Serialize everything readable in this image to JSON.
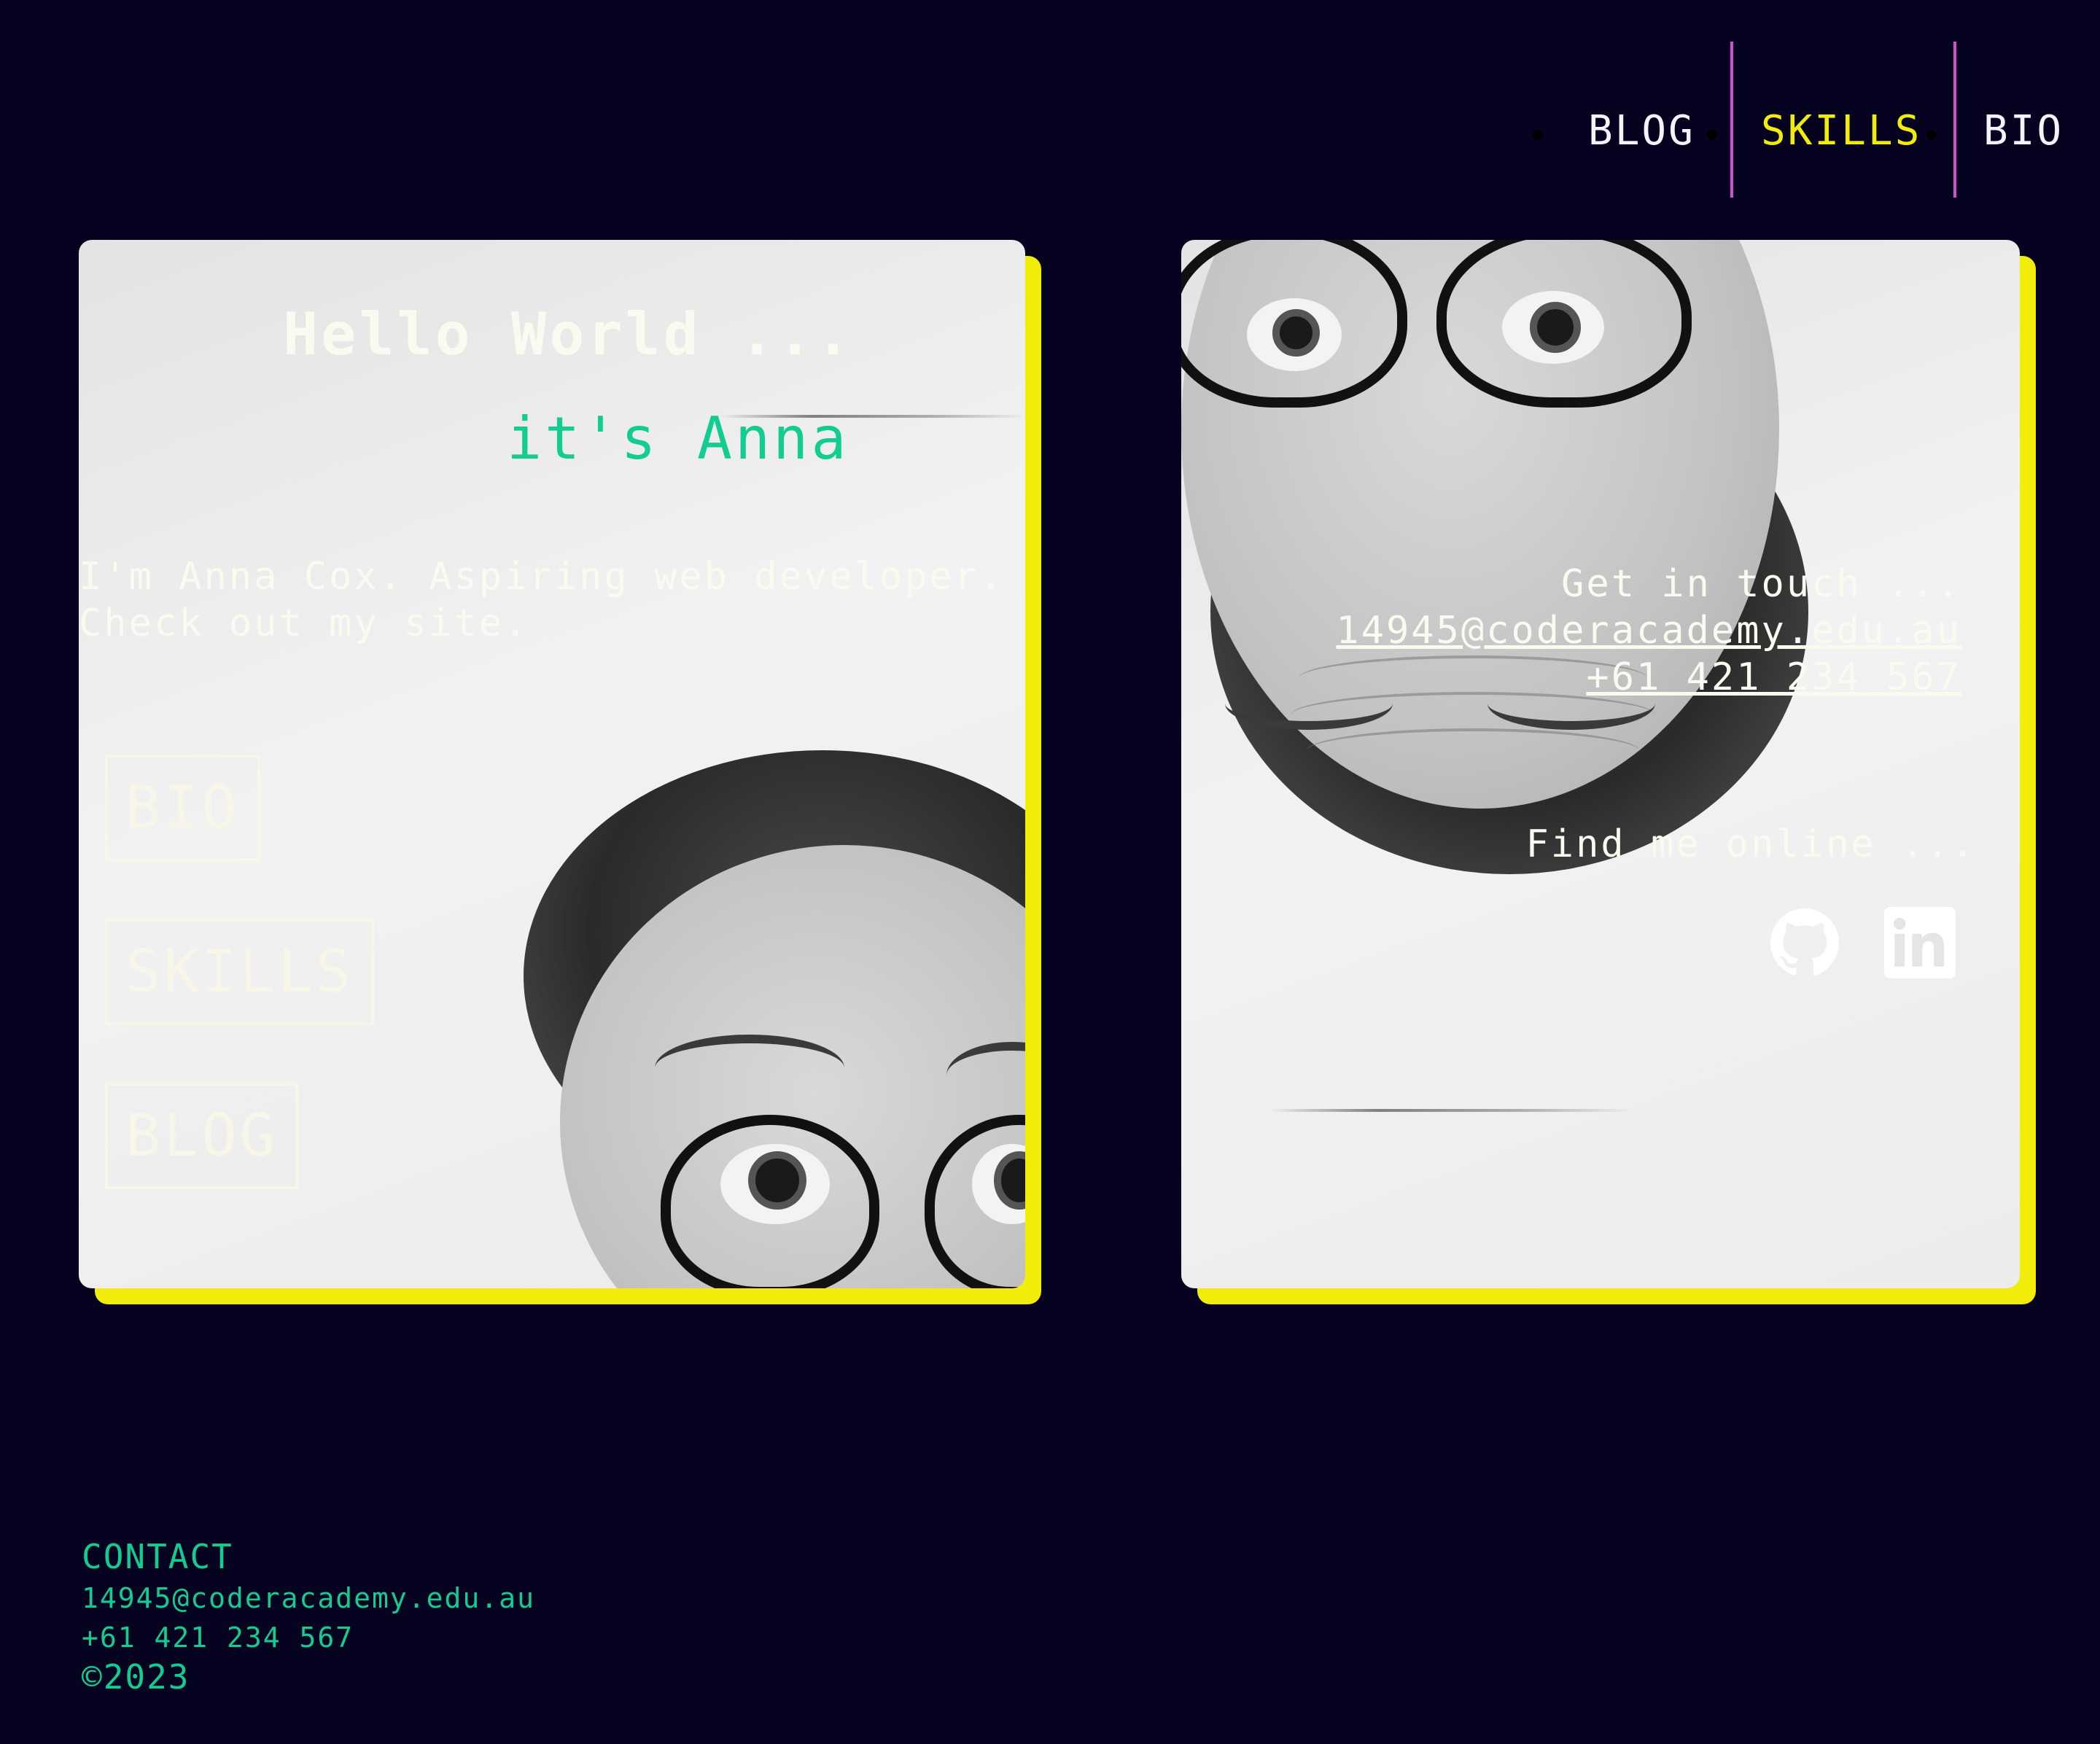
{
  "nav": {
    "items": [
      {
        "label": "BLOG"
      },
      {
        "label": "SKILLS",
        "active": true
      },
      {
        "label": "BIO"
      }
    ]
  },
  "hero": {
    "greeting": "Hello World ...",
    "name_line": "it's Anna",
    "intro": "I'm Anna Cox. Aspiring web developer. Check out my site.",
    "buttons": [
      "BIO",
      "SKILLS",
      "BLOG"
    ]
  },
  "contact_card": {
    "heading": "Get in touch ...",
    "email": "14945@coderacademy.edu.au",
    "phone": "+61 421 234 567",
    "online_heading": "Find me online ...",
    "social_icons": [
      "github-icon",
      "linkedin-icon"
    ]
  },
  "footer": {
    "title": "CONTACT",
    "email": "14945@coderacademy.edu.au",
    "phone": "+61 421 234 567",
    "copyright": "©2023"
  },
  "colors": {
    "background": "#05031f",
    "accent_yellow": "#f2ec0a",
    "accent_green": "#13cc92",
    "separator_pink": "#d050d0"
  }
}
